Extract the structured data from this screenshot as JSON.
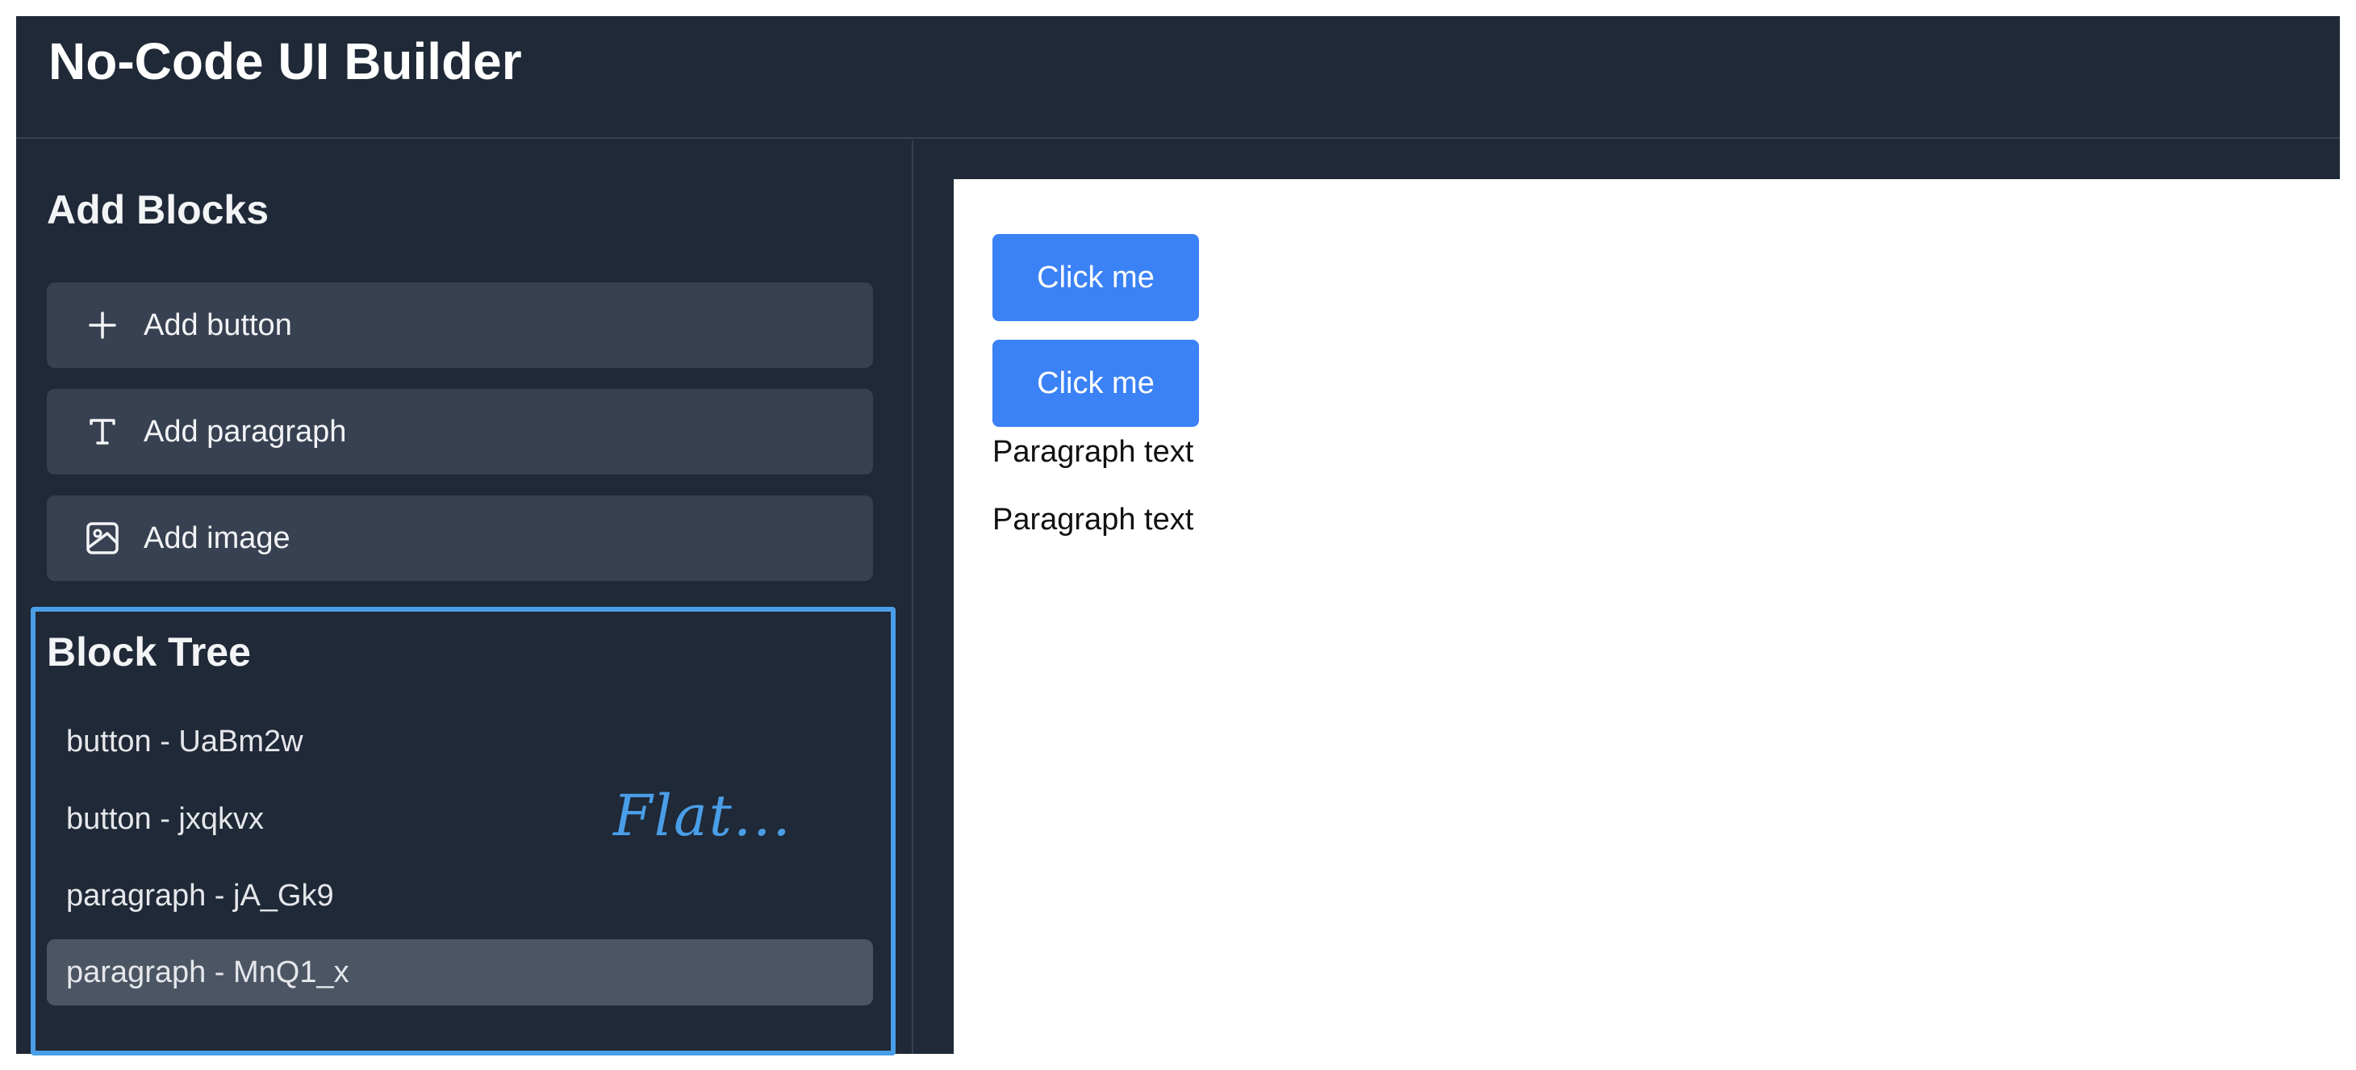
{
  "header": {
    "title": "No-Code UI Builder"
  },
  "sidebar": {
    "add_blocks_title": "Add Blocks",
    "add_items": [
      {
        "label": "Add button",
        "icon": "plus-icon"
      },
      {
        "label": "Add paragraph",
        "icon": "text-icon"
      },
      {
        "label": "Add image",
        "icon": "image-icon"
      }
    ],
    "block_tree_title": "Block Tree",
    "tree_items": [
      {
        "label": "button - UaBm2w",
        "selected": false
      },
      {
        "label": "button - jxqkvx",
        "selected": false
      },
      {
        "label": "paragraph - jA_Gk9",
        "selected": false
      },
      {
        "label": "paragraph - MnQ1_x",
        "selected": true
      }
    ],
    "annotation": "Flat..."
  },
  "canvas": {
    "buttons": [
      {
        "label": "Click me"
      },
      {
        "label": "Click me"
      }
    ],
    "paragraphs": [
      {
        "text": "Paragraph text"
      },
      {
        "text": "Paragraph text"
      }
    ]
  },
  "colors": {
    "app_background": "#1f2937",
    "panel_button": "#374151",
    "selected_row": "#4b5563",
    "canvas_button": "#3b82f6",
    "annotation": "#4a9ee8"
  }
}
